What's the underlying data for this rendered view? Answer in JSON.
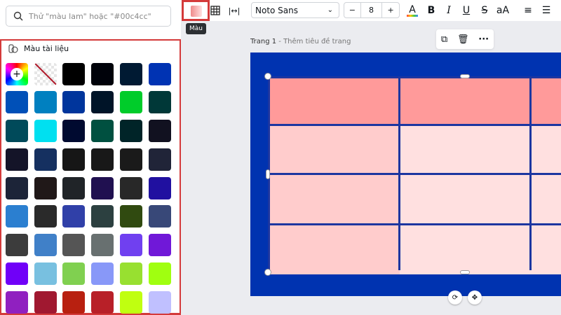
{
  "search": {
    "placeholder": "Thử \"màu lam\" hoặc \"#00c4cc\""
  },
  "panel": {
    "title": "Màu tài liệu",
    "swatches": [
      [
        "rainbow",
        "transparent",
        "#000000",
        "#00020a",
        "#001a33",
        "#0033b3"
      ],
      [
        "#0050b8",
        "#0080c0",
        "#00359c",
        "#001428",
        "#00cc2a",
        "#003838"
      ],
      [
        "#004a5a",
        "#00e0f0",
        "#000a30",
        "#005040",
        "#002428",
        "#111120"
      ],
      [
        "#141428",
        "#153060",
        "#161616",
        "#181818",
        "#1a1a1a",
        "#202438"
      ],
      [
        "#1c2438",
        "#201818",
        "#202428",
        "#201050",
        "#282828",
        "#2010a0"
      ],
      [
        "#2b7fd0",
        "#2a2a2a",
        "#3040a8",
        "#2c4040",
        "#304a10",
        "#384878"
      ],
      [
        "#3c3c3c",
        "#4080c8",
        "#555555",
        "#687070",
        "#7040f0",
        "#7018d8"
      ],
      [
        "#7000f8",
        "#78c0e0",
        "#80d050",
        "#8898f8",
        "#98e030",
        "#a0ff10"
      ],
      [
        "#9020c0",
        "#a01830",
        "#b82010",
        "#b82028",
        "#c0ff10",
        "#c0c0ff"
      ]
    ]
  },
  "toolbar": {
    "color_tooltip": "Màu",
    "font": "Noto Sans",
    "font_size": "8",
    "minus": "−",
    "plus": "+",
    "bold": "B",
    "italic": "I",
    "underline": "U",
    "strike": "S",
    "case": "aA"
  },
  "page": {
    "label": "Trang 1",
    "title_placeholder": " - Thêm tiêu đề trang"
  },
  "colors": {
    "accent": "#d43a3a",
    "canvas": "#0033b0",
    "header_cell": "#ff9a9a",
    "first_col": "#ffcccc",
    "body_cell": "#ffe0e0"
  }
}
